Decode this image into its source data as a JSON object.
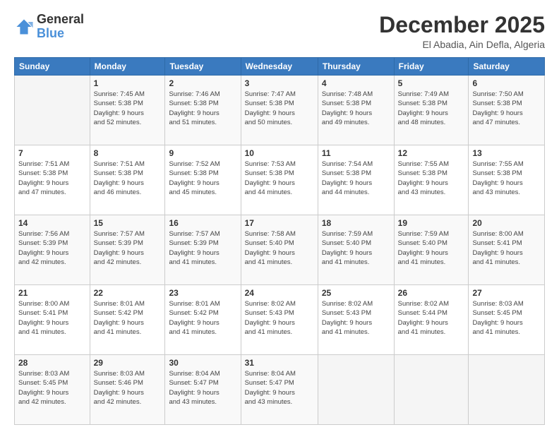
{
  "logo": {
    "line1": "General",
    "line2": "Blue"
  },
  "header": {
    "month_year": "December 2025",
    "location": "El Abadia, Ain Defla, Algeria"
  },
  "weekdays": [
    "Sunday",
    "Monday",
    "Tuesday",
    "Wednesday",
    "Thursday",
    "Friday",
    "Saturday"
  ],
  "weeks": [
    [
      {
        "day": "",
        "sunrise": "",
        "sunset": "",
        "daylight": ""
      },
      {
        "day": "1",
        "sunrise": "Sunrise: 7:45 AM",
        "sunset": "Sunset: 5:38 PM",
        "daylight": "Daylight: 9 hours and 52 minutes."
      },
      {
        "day": "2",
        "sunrise": "Sunrise: 7:46 AM",
        "sunset": "Sunset: 5:38 PM",
        "daylight": "Daylight: 9 hours and 51 minutes."
      },
      {
        "day": "3",
        "sunrise": "Sunrise: 7:47 AM",
        "sunset": "Sunset: 5:38 PM",
        "daylight": "Daylight: 9 hours and 50 minutes."
      },
      {
        "day": "4",
        "sunrise": "Sunrise: 7:48 AM",
        "sunset": "Sunset: 5:38 PM",
        "daylight": "Daylight: 9 hours and 49 minutes."
      },
      {
        "day": "5",
        "sunrise": "Sunrise: 7:49 AM",
        "sunset": "Sunset: 5:38 PM",
        "daylight": "Daylight: 9 hours and 48 minutes."
      },
      {
        "day": "6",
        "sunrise": "Sunrise: 7:50 AM",
        "sunset": "Sunset: 5:38 PM",
        "daylight": "Daylight: 9 hours and 47 minutes."
      }
    ],
    [
      {
        "day": "7",
        "sunrise": "Sunrise: 7:51 AM",
        "sunset": "Sunset: 5:38 PM",
        "daylight": "Daylight: 9 hours and 47 minutes."
      },
      {
        "day": "8",
        "sunrise": "Sunrise: 7:51 AM",
        "sunset": "Sunset: 5:38 PM",
        "daylight": "Daylight: 9 hours and 46 minutes."
      },
      {
        "day": "9",
        "sunrise": "Sunrise: 7:52 AM",
        "sunset": "Sunset: 5:38 PM",
        "daylight": "Daylight: 9 hours and 45 minutes."
      },
      {
        "day": "10",
        "sunrise": "Sunrise: 7:53 AM",
        "sunset": "Sunset: 5:38 PM",
        "daylight": "Daylight: 9 hours and 44 minutes."
      },
      {
        "day": "11",
        "sunrise": "Sunrise: 7:54 AM",
        "sunset": "Sunset: 5:38 PM",
        "daylight": "Daylight: 9 hours and 44 minutes."
      },
      {
        "day": "12",
        "sunrise": "Sunrise: 7:55 AM",
        "sunset": "Sunset: 5:38 PM",
        "daylight": "Daylight: 9 hours and 43 minutes."
      },
      {
        "day": "13",
        "sunrise": "Sunrise: 7:55 AM",
        "sunset": "Sunset: 5:38 PM",
        "daylight": "Daylight: 9 hours and 43 minutes."
      }
    ],
    [
      {
        "day": "14",
        "sunrise": "Sunrise: 7:56 AM",
        "sunset": "Sunset: 5:39 PM",
        "daylight": "Daylight: 9 hours and 42 minutes."
      },
      {
        "day": "15",
        "sunrise": "Sunrise: 7:57 AM",
        "sunset": "Sunset: 5:39 PM",
        "daylight": "Daylight: 9 hours and 42 minutes."
      },
      {
        "day": "16",
        "sunrise": "Sunrise: 7:57 AM",
        "sunset": "Sunset: 5:39 PM",
        "daylight": "Daylight: 9 hours and 41 minutes."
      },
      {
        "day": "17",
        "sunrise": "Sunrise: 7:58 AM",
        "sunset": "Sunset: 5:40 PM",
        "daylight": "Daylight: 9 hours and 41 minutes."
      },
      {
        "day": "18",
        "sunrise": "Sunrise: 7:59 AM",
        "sunset": "Sunset: 5:40 PM",
        "daylight": "Daylight: 9 hours and 41 minutes."
      },
      {
        "day": "19",
        "sunrise": "Sunrise: 7:59 AM",
        "sunset": "Sunset: 5:40 PM",
        "daylight": "Daylight: 9 hours and 41 minutes."
      },
      {
        "day": "20",
        "sunrise": "Sunrise: 8:00 AM",
        "sunset": "Sunset: 5:41 PM",
        "daylight": "Daylight: 9 hours and 41 minutes."
      }
    ],
    [
      {
        "day": "21",
        "sunrise": "Sunrise: 8:00 AM",
        "sunset": "Sunset: 5:41 PM",
        "daylight": "Daylight: 9 hours and 41 minutes."
      },
      {
        "day": "22",
        "sunrise": "Sunrise: 8:01 AM",
        "sunset": "Sunset: 5:42 PM",
        "daylight": "Daylight: 9 hours and 41 minutes."
      },
      {
        "day": "23",
        "sunrise": "Sunrise: 8:01 AM",
        "sunset": "Sunset: 5:42 PM",
        "daylight": "Daylight: 9 hours and 41 minutes."
      },
      {
        "day": "24",
        "sunrise": "Sunrise: 8:02 AM",
        "sunset": "Sunset: 5:43 PM",
        "daylight": "Daylight: 9 hours and 41 minutes."
      },
      {
        "day": "25",
        "sunrise": "Sunrise: 8:02 AM",
        "sunset": "Sunset: 5:43 PM",
        "daylight": "Daylight: 9 hours and 41 minutes."
      },
      {
        "day": "26",
        "sunrise": "Sunrise: 8:02 AM",
        "sunset": "Sunset: 5:44 PM",
        "daylight": "Daylight: 9 hours and 41 minutes."
      },
      {
        "day": "27",
        "sunrise": "Sunrise: 8:03 AM",
        "sunset": "Sunset: 5:45 PM",
        "daylight": "Daylight: 9 hours and 41 minutes."
      }
    ],
    [
      {
        "day": "28",
        "sunrise": "Sunrise: 8:03 AM",
        "sunset": "Sunset: 5:45 PM",
        "daylight": "Daylight: 9 hours and 42 minutes."
      },
      {
        "day": "29",
        "sunrise": "Sunrise: 8:03 AM",
        "sunset": "Sunset: 5:46 PM",
        "daylight": "Daylight: 9 hours and 42 minutes."
      },
      {
        "day": "30",
        "sunrise": "Sunrise: 8:04 AM",
        "sunset": "Sunset: 5:47 PM",
        "daylight": "Daylight: 9 hours and 43 minutes."
      },
      {
        "day": "31",
        "sunrise": "Sunrise: 8:04 AM",
        "sunset": "Sunset: 5:47 PM",
        "daylight": "Daylight: 9 hours and 43 minutes."
      },
      {
        "day": "",
        "sunrise": "",
        "sunset": "",
        "daylight": ""
      },
      {
        "day": "",
        "sunrise": "",
        "sunset": "",
        "daylight": ""
      },
      {
        "day": "",
        "sunrise": "",
        "sunset": "",
        "daylight": ""
      }
    ]
  ]
}
